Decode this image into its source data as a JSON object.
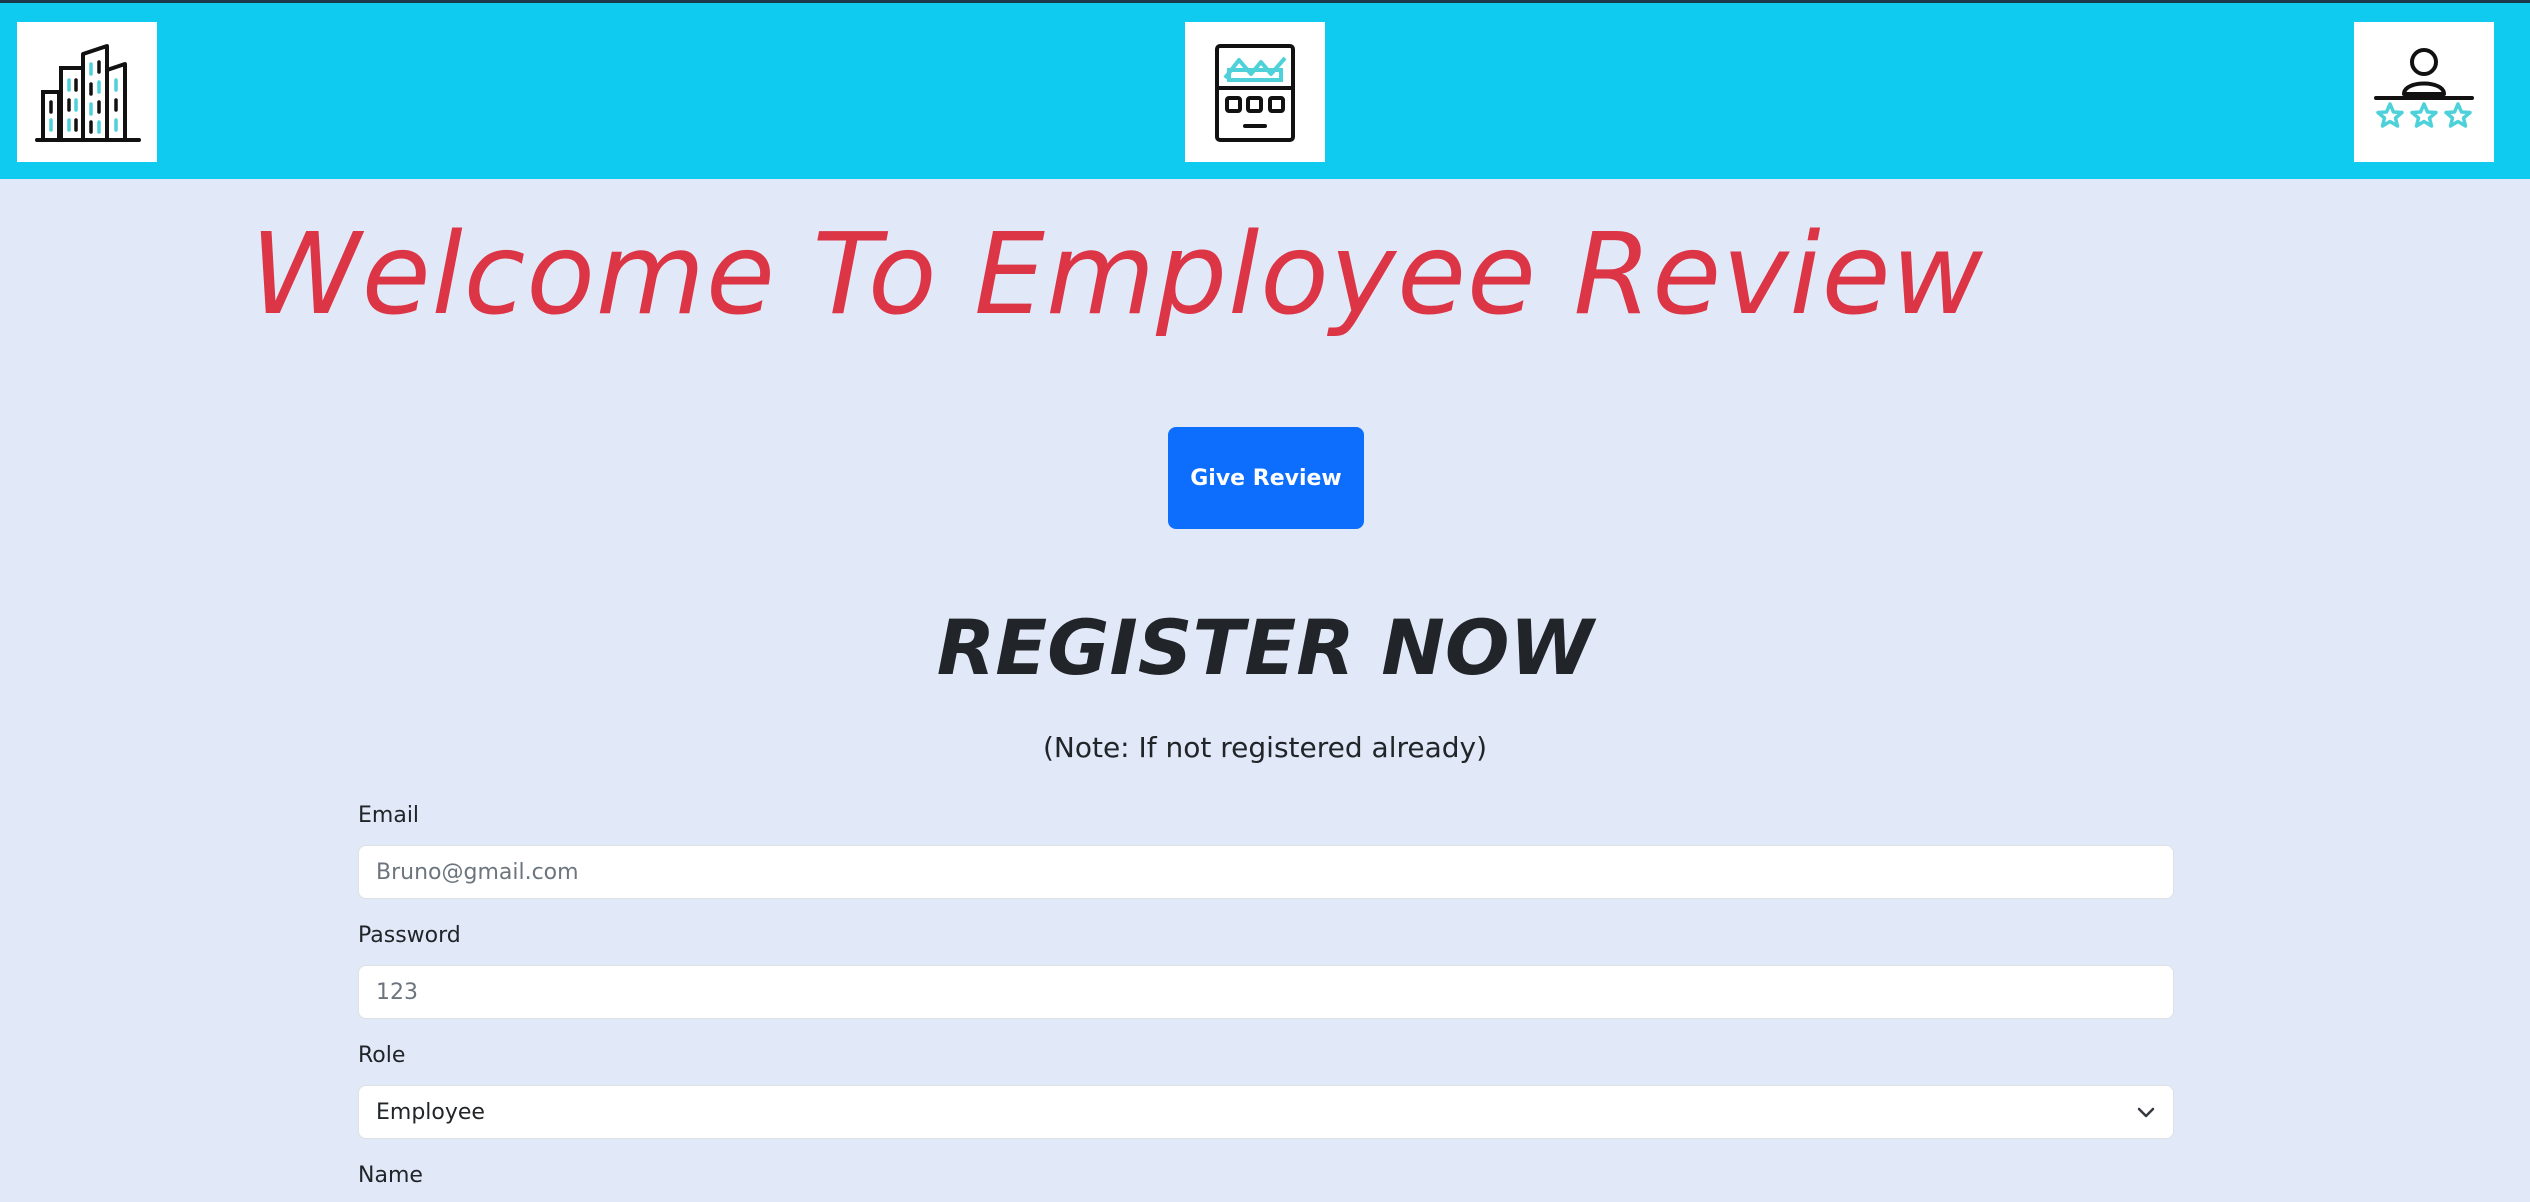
{
  "header": {
    "left_icon": "office-building-icon",
    "center_icon": "store-kiosk-icon",
    "right_icon": "user-rating-stars-icon",
    "background_color": "#10cbf0"
  },
  "main": {
    "welcome_title": "Welcome To Employee Review",
    "give_review_label": "Give Review",
    "register_title": "REGISTER NOW",
    "register_note": "(Note: If not registered already)"
  },
  "form": {
    "email": {
      "label": "Email",
      "placeholder": "Bruno@gmail.com"
    },
    "password": {
      "label": "Password",
      "placeholder": "123"
    },
    "role": {
      "label": "Role",
      "selected": "Employee"
    },
    "name": {
      "label": "Name"
    }
  },
  "colors": {
    "accent_red": "#dc3545",
    "primary_blue": "#0d6efd",
    "page_background": "#e1e8f7",
    "icon_cyan": "#4fd1d9"
  }
}
